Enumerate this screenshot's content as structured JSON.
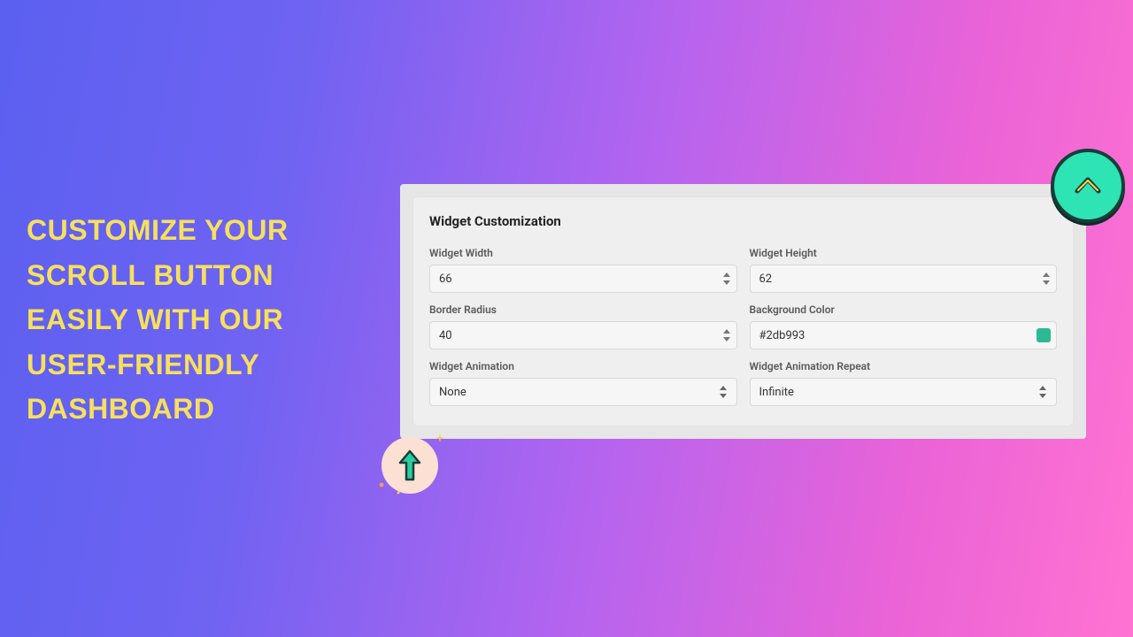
{
  "headline": "Customize your scroll button easily with our user-friendly dashboard",
  "panel": {
    "title": "Widget Customization",
    "fields": {
      "widget_width": {
        "label": "Widget Width",
        "value": "66"
      },
      "widget_height": {
        "label": "Widget Height",
        "value": "62"
      },
      "border_radius": {
        "label": "Border Radius",
        "value": "40"
      },
      "bg_color": {
        "label": "Background Color",
        "value": "#2db993",
        "swatch": "#2db993"
      },
      "animation": {
        "label": "Widget Animation",
        "value": "None"
      },
      "animation_repeat": {
        "label": "Widget Animation Repeat",
        "value": "Infinite"
      }
    }
  },
  "colors": {
    "accent_teal": "#2db993"
  }
}
